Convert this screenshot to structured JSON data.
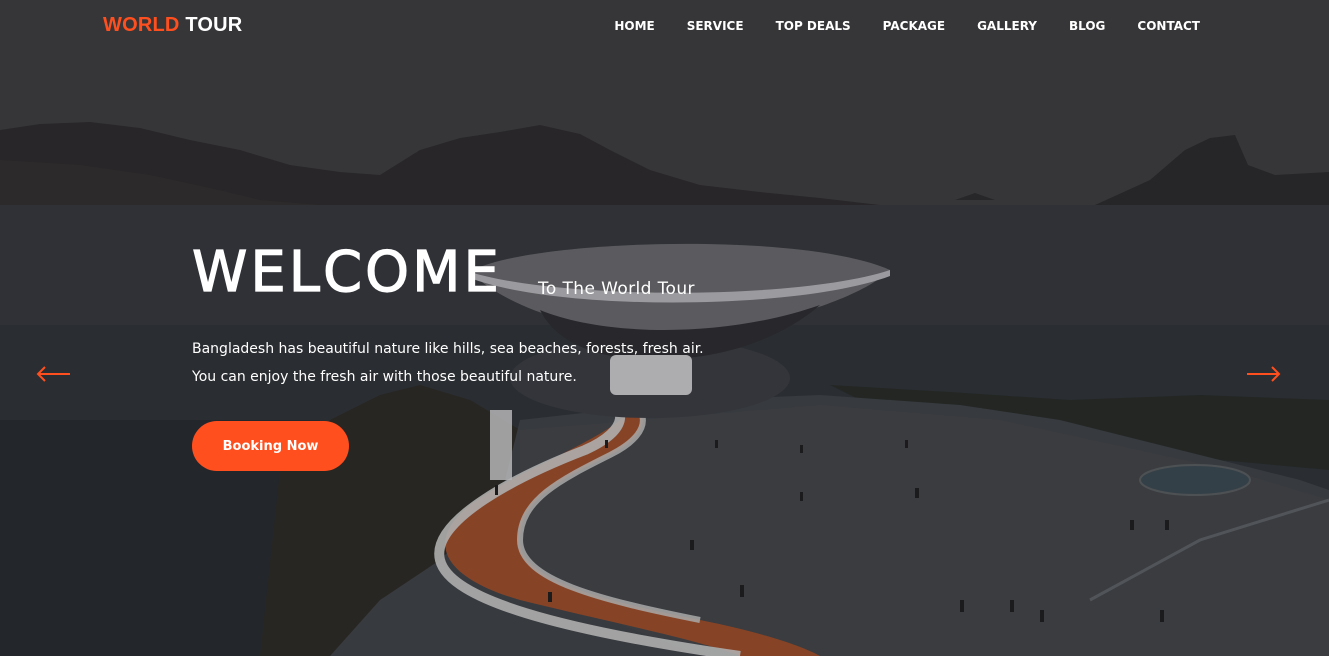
{
  "brand": {
    "part1": "WORLD",
    "part2": "TOUR",
    "accent": "#ff4f1f"
  },
  "nav": {
    "items": [
      "HOME",
      "SERVICE",
      "TOP DEALS",
      "PACKAGE",
      "GALLERY",
      "BLOG",
      "CONTACT"
    ]
  },
  "hero": {
    "headline": "WELCOME",
    "tagline": "To The World Tour",
    "description_line1": "Bangladesh has beautiful nature like hills, sea beaches, forests, fresh air.",
    "description_line2": "You can enjoy the fresh air with those beautiful nature.",
    "cta_label": "Booking Now",
    "prev_icon": "arrow-left-icon",
    "next_icon": "arrow-right-icon"
  }
}
